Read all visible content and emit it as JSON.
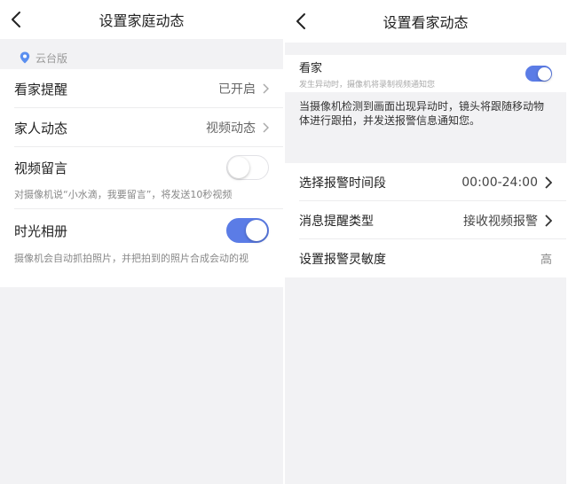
{
  "left": {
    "title": "设置家庭动态",
    "section_label": "云台版",
    "rows": {
      "guard": {
        "label": "看家提醒",
        "value": "已开启"
      },
      "family": {
        "label": "家人动态",
        "value": "视频动态"
      },
      "video_msg": {
        "label": "视频留言",
        "toggle_on": false,
        "desc": "对摄像机说“小水滴，我要留言”，将发送10秒视频"
      },
      "album": {
        "label": "时光相册",
        "toggle_on": true,
        "desc": "摄像机会自动抓拍照片，并把拍到的照片合成会动的视"
      }
    }
  },
  "right": {
    "title": "设置看家动态",
    "guard": {
      "label": "看家",
      "sub": "发生异动时，摄像机将录制视频通知您",
      "toggle_on": true
    },
    "info": "当摄像机检测到画面出现异动时，镜头将跟随移动物体进行跟拍，并发送报警信息通知您。",
    "rows": {
      "time": {
        "label": "选择报警时间段",
        "value": "00:00-24:00"
      },
      "type": {
        "label": "消息提醒类型",
        "value": "接收视频报警"
      },
      "sens": {
        "label": "设置报警灵敏度",
        "value": "高"
      }
    }
  },
  "colors": {
    "accent": "#5b7ce6",
    "background": "#f2f2f4",
    "card": "#ffffff"
  }
}
